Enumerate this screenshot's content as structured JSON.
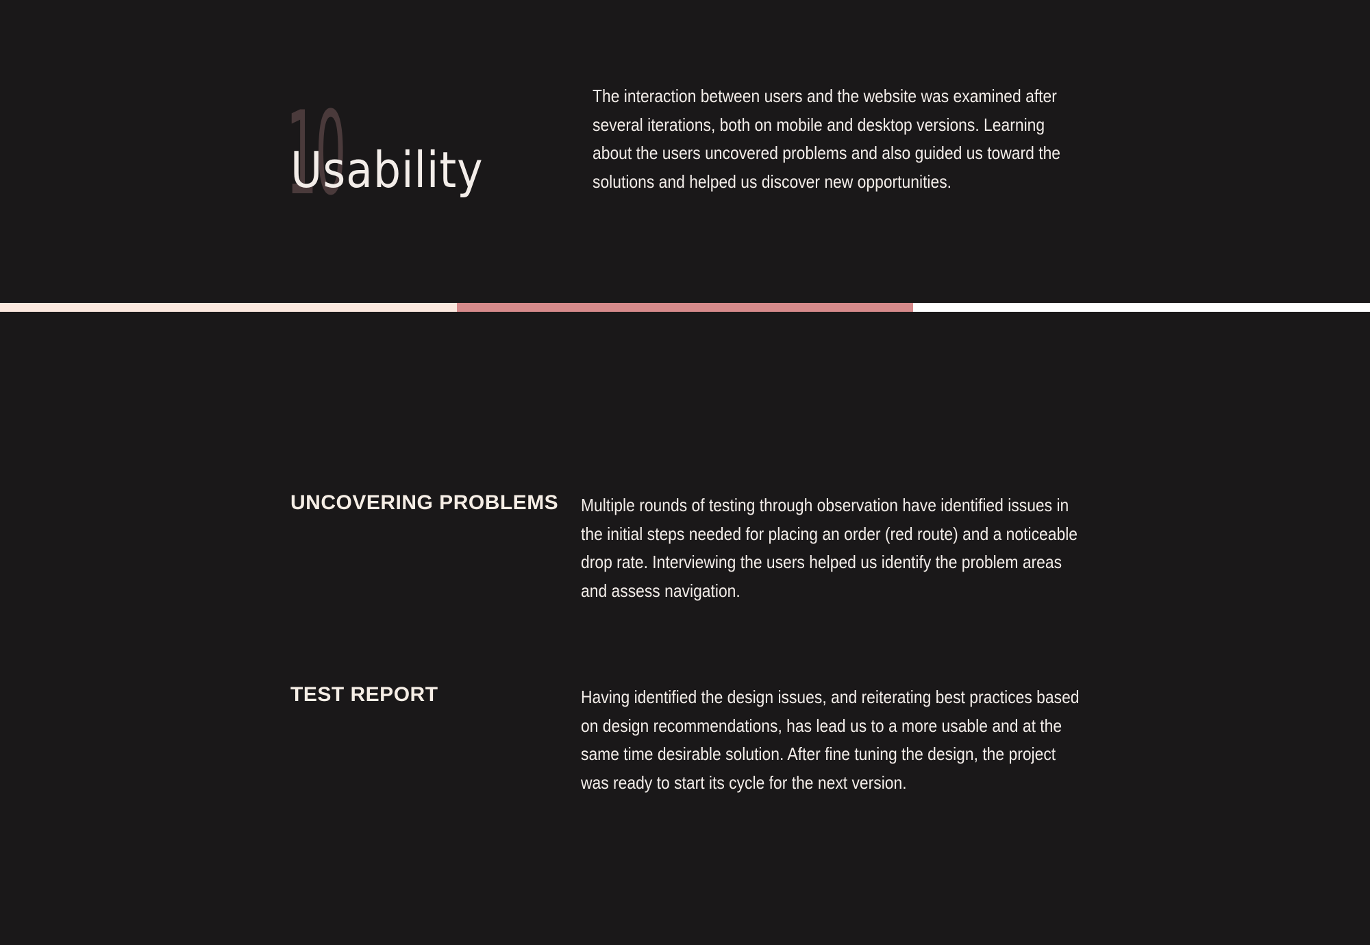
{
  "section": {
    "number": "10",
    "title": "Usability",
    "intro": "The interaction between users and the website was examined after several iterations, both on mobile and desktop versions. Learning about the users uncovered problems and also guided us toward the solutions and helped us discover new opportunities."
  },
  "stripe": {
    "colors": [
      "#fbe8df",
      "#d68a8b",
      "#ffffff"
    ]
  },
  "blocks": [
    {
      "heading": "UNCOVERING PROBLEMS",
      "text": "Multiple rounds of testing through observation have identified issues in the initial steps needed for placing an order (red route) and a noticeable drop rate. Interviewing the users helped us identify the problem areas and assess navigation."
    },
    {
      "heading": "TEST REPORT",
      "text": "Having identified the design issues, and reiterating best practices based on design recommendations, has lead us to a more usable and at the same time desirable solution. After fine tuning the design, the project was ready to start its cycle for the next version."
    }
  ],
  "colors": {
    "background": "#1a1819",
    "number": "#4a3a3b",
    "text": "#f3ede9"
  }
}
